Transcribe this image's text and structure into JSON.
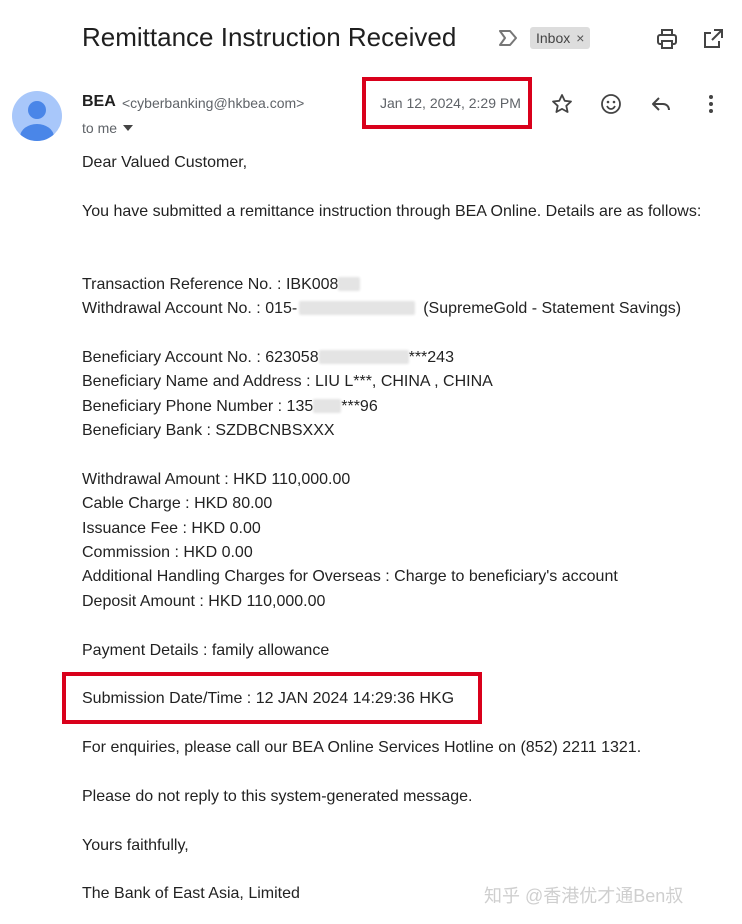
{
  "email": {
    "subject": "Remittance Instruction Received",
    "label": "Inbox",
    "sender_name": "BEA",
    "sender_email": "<cyberbanking@hkbea.com>",
    "recipient": "to me",
    "date": "Jan 12, 2024, 2:29 PM"
  },
  "body": {
    "greeting": "Dear Valued Customer,",
    "intro": "You have submitted a remittance instruction through BEA Online. Details are as follows:",
    "txn_ref": "Transaction Reference No. : IBK008",
    "withdrawal_acct_prefix": "Withdrawal Account No. : 015-",
    "withdrawal_acct_suffix": "(SupremeGold - Statement Savings)",
    "bene_acct_prefix": "Beneficiary Account No. : 623058",
    "bene_acct_suffix": "***243",
    "bene_name": "Beneficiary Name and Address : LIU L***, CHINA , CHINA",
    "bene_phone_prefix": "Beneficiary Phone Number : 135",
    "bene_phone_suffix": "***96",
    "bene_bank": "Beneficiary Bank : SZDBCNBSXXX",
    "withdrawal_amount": "Withdrawal Amount : HKD 110,000.00",
    "cable_charge": "Cable Charge : HKD 80.00",
    "issuance_fee": "Issuance Fee : HKD 0.00",
    "commission": "Commission : HKD 0.00",
    "handling": "Additional Handling Charges for Overseas : Charge to beneficiary's account",
    "deposit_amount": "Deposit Amount : HKD 110,000.00",
    "payment_details": "Payment Details : family allowance",
    "submission": "Submission Date/Time : 12 JAN 2024 14:29:36 HKG",
    "enquiries": "For enquiries, please call our BEA Online Services Hotline on (852) 2211 1321.",
    "no_reply": "Please do not reply to this system-generated message.",
    "closing": "Yours faithfully,",
    "signature": "The Bank of East Asia, Limited"
  },
  "watermark": "知乎 @香港优才通Ben叔",
  "colors": {
    "highlight": "#d9001b",
    "avatar": "#a8c7fa",
    "avatar_figure": "#4a86e8"
  },
  "icons": [
    "label-arrow-icon",
    "print-icon",
    "open-in-new-icon",
    "star-icon",
    "emoji-icon",
    "reply-icon",
    "more-vert-icon",
    "caret-down-icon",
    "close-icon"
  ]
}
